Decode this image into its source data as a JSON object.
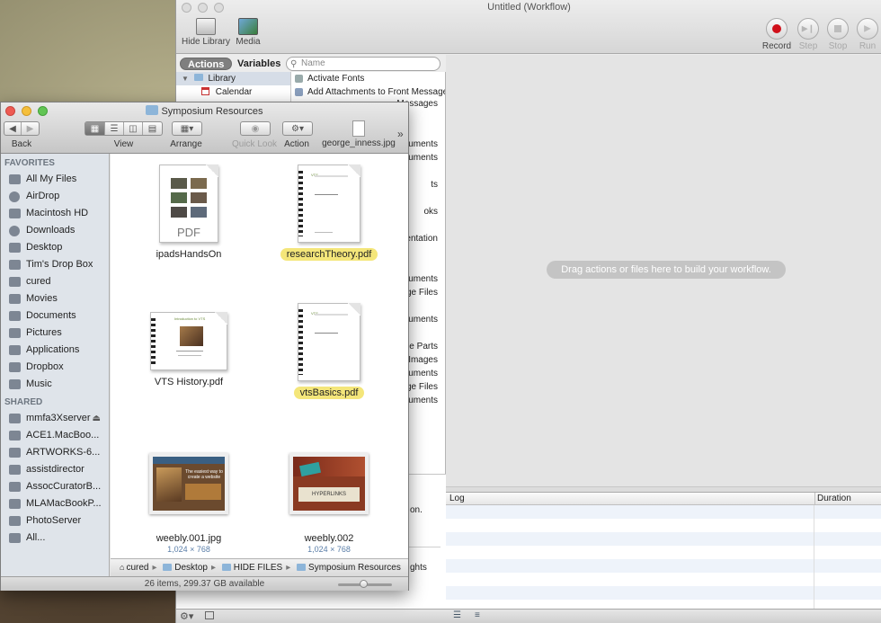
{
  "automator": {
    "title": "Untitled (Workflow)",
    "toolbar": {
      "hide_library": "Hide Library",
      "media": "Media",
      "record": "Record",
      "step": "Step",
      "stop": "Stop",
      "run": "Run"
    },
    "tabs": {
      "actions": "Actions",
      "variables": "Variables"
    },
    "search_placeholder": "Name",
    "library": [
      {
        "label": "Library"
      },
      {
        "label": "Calendar"
      }
    ],
    "actions_list": [
      {
        "label": "Activate Fonts"
      },
      {
        "label": "Add Attachments to Front Message"
      }
    ],
    "partial_actions": [
      "Messages",
      "cuments",
      "cuments",
      "ts",
      "oks",
      "entation",
      "cuments",
      "age Files",
      "cuments",
      "de Parts",
      "Images",
      "cuments",
      "age Files",
      "cuments"
    ],
    "description_fragments": [
      "on.",
      "ghts"
    ],
    "drop_hint": "Drag actions or files here to build your workflow.",
    "log": {
      "col_log": "Log",
      "col_duration": "Duration"
    }
  },
  "finder": {
    "title": "Symposium Resources",
    "toolbar": {
      "back": "Back",
      "view": "View",
      "arrange": "Arrange",
      "quick_look": "Quick Look",
      "action": "Action",
      "file_shortcut": "george_inness.jpg"
    },
    "sidebar": {
      "favorites_header": "FAVORITES",
      "favorites": [
        {
          "label": "All My Files",
          "icon": "all-files-icon"
        },
        {
          "label": "AirDrop",
          "icon": "airdrop-icon"
        },
        {
          "label": "Macintosh HD",
          "icon": "hard-drive-icon"
        },
        {
          "label": "Downloads",
          "icon": "downloads-icon"
        },
        {
          "label": "Desktop",
          "icon": "desktop-icon"
        },
        {
          "label": "Tim's Drop Box",
          "icon": "folder-icon"
        },
        {
          "label": "cured",
          "icon": "home-icon"
        },
        {
          "label": "Movies",
          "icon": "movies-icon"
        },
        {
          "label": "Documents",
          "icon": "documents-icon"
        },
        {
          "label": "Pictures",
          "icon": "pictures-icon"
        },
        {
          "label": "Applications",
          "icon": "applications-icon"
        },
        {
          "label": "Dropbox",
          "icon": "folder-icon"
        },
        {
          "label": "Music",
          "icon": "music-icon"
        }
      ],
      "shared_header": "SHARED",
      "shared": [
        {
          "label": "mmfa3Xserver",
          "icon": "server-icon"
        },
        {
          "label": "ACE1.MacBoo...",
          "icon": "computer-icon"
        },
        {
          "label": "ARTWORKS-6...",
          "icon": "computer-icon"
        },
        {
          "label": "assistdirector",
          "icon": "computer-icon"
        },
        {
          "label": "AssocCuratorB...",
          "icon": "computer-icon"
        },
        {
          "label": "MLAMacBookP...",
          "icon": "computer-icon"
        },
        {
          "label": "PhotoServer",
          "icon": "computer-icon"
        },
        {
          "label": "All...",
          "icon": "network-icon"
        }
      ]
    },
    "files": [
      {
        "name": "ipadsHandsOn",
        "sub": "",
        "kind": "pdf-generic",
        "badge": "PDF"
      },
      {
        "name": "researchTheory.pdf",
        "sub": "",
        "kind": "pdf-doc",
        "highlight": true
      },
      {
        "name": "VTS History.pdf",
        "sub": "",
        "kind": "pdf-spiral"
      },
      {
        "name": "vtsBasics.pdf",
        "sub": "",
        "kind": "pdf-doc",
        "highlight": true
      },
      {
        "name": "weebly.001.jpg",
        "sub": "1,024 × 768",
        "kind": "image"
      },
      {
        "name": "weebly.002",
        "sub": "1,024 × 768",
        "kind": "image"
      }
    ],
    "thumb_text": {
      "vts_header": "VTS",
      "vts_history_title": "Introduction to VTS",
      "weebly1_title": "The easiest way to create a website",
      "weebly2_title": "HYPERLINKS"
    },
    "path": [
      "cured",
      "Desktop",
      "HIDE FILES",
      "Symposium Resources"
    ],
    "status": "26 items, 299.37 GB available"
  }
}
